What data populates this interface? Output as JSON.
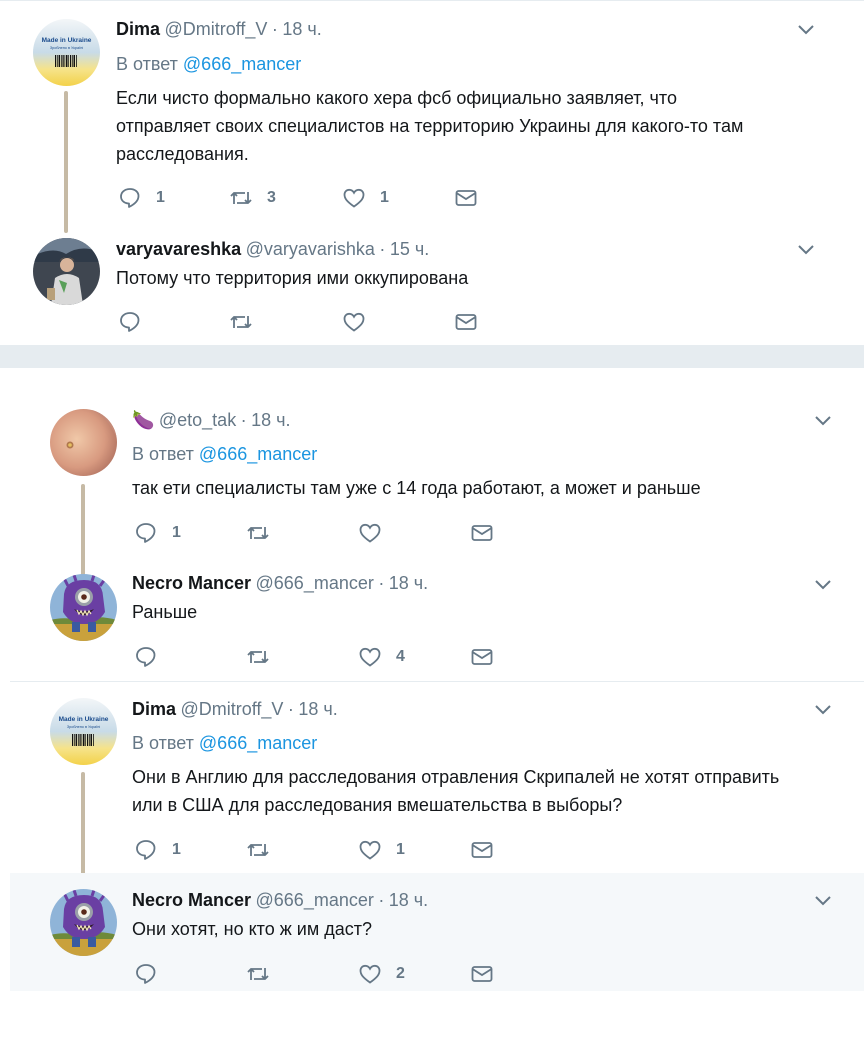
{
  "tweets": [
    {
      "id": "t1",
      "name": "Dima",
      "handle": "@Dmitroff_V",
      "time": "18 ч.",
      "reply_prefix": "В ответ",
      "reply_to": "@666_mancer",
      "text_lines": [
        "Если чисто формально какого хера фсб официально заявляет, что",
        "отправляет своих специалистов на территорию Украины для какого-то там",
        "расследования."
      ],
      "replies": "1",
      "retweets": "3",
      "likes": "1",
      "avatar": "made-in-ukraine"
    },
    {
      "id": "t2",
      "name": "varyavareshka",
      "handle": "@varyavarishka",
      "time": "15 ч.",
      "text_lines": [
        "Потому что территория ими оккупирована"
      ],
      "replies": "",
      "retweets": "",
      "likes": "",
      "avatar": "person-photo"
    },
    {
      "id": "t3",
      "name": "🍆",
      "handle": "@eto_tak",
      "time": "18 ч.",
      "reply_prefix": "В ответ",
      "reply_to": "@666_mancer",
      "text_lines": [
        "так ети специалисты там уже с 14 года работают, а может и раньше"
      ],
      "replies": "1",
      "retweets": "",
      "likes": "",
      "avatar": "peach-photo"
    },
    {
      "id": "t4",
      "name": "Necro Mancer",
      "handle": "@666_mancer",
      "time": "18 ч.",
      "text_lines": [
        "Раньше"
      ],
      "replies": "",
      "retweets": "",
      "likes": "4",
      "avatar": "purple-minion"
    },
    {
      "id": "t5",
      "name": "Dima",
      "handle": "@Dmitroff_V",
      "time": "18 ч.",
      "reply_prefix": "В ответ",
      "reply_to": "@666_mancer",
      "text_lines": [
        "Они в Англию для расследования отравления Скрипалей не хотят отправить",
        "или в США для расследования вмешательства в выборы?"
      ],
      "replies": "1",
      "retweets": "",
      "likes": "1",
      "avatar": "made-in-ukraine"
    },
    {
      "id": "t6",
      "name": "Necro Mancer",
      "handle": "@666_mancer",
      "time": "18 ч.",
      "text_lines": [
        "Они хотят, но кто ж им даст?"
      ],
      "replies": "",
      "retweets": "",
      "likes": "2",
      "avatar": "purple-minion"
    }
  ],
  "avatar_art": {
    "made_in_ukraine_line1": "Made in Ukraine",
    "made_in_ukraine_line2": "Зроблено в Україні"
  },
  "icons": {
    "reply": "reply-icon",
    "retweet": "retweet-icon",
    "like": "heart-icon",
    "dm": "envelope-icon",
    "caret": "chevron-down-icon"
  },
  "colors": {
    "mention": "#1b95e0",
    "secondary": "#657786",
    "thread_line": "#c6baa5",
    "highlight_bg": "#f5f8fa"
  }
}
